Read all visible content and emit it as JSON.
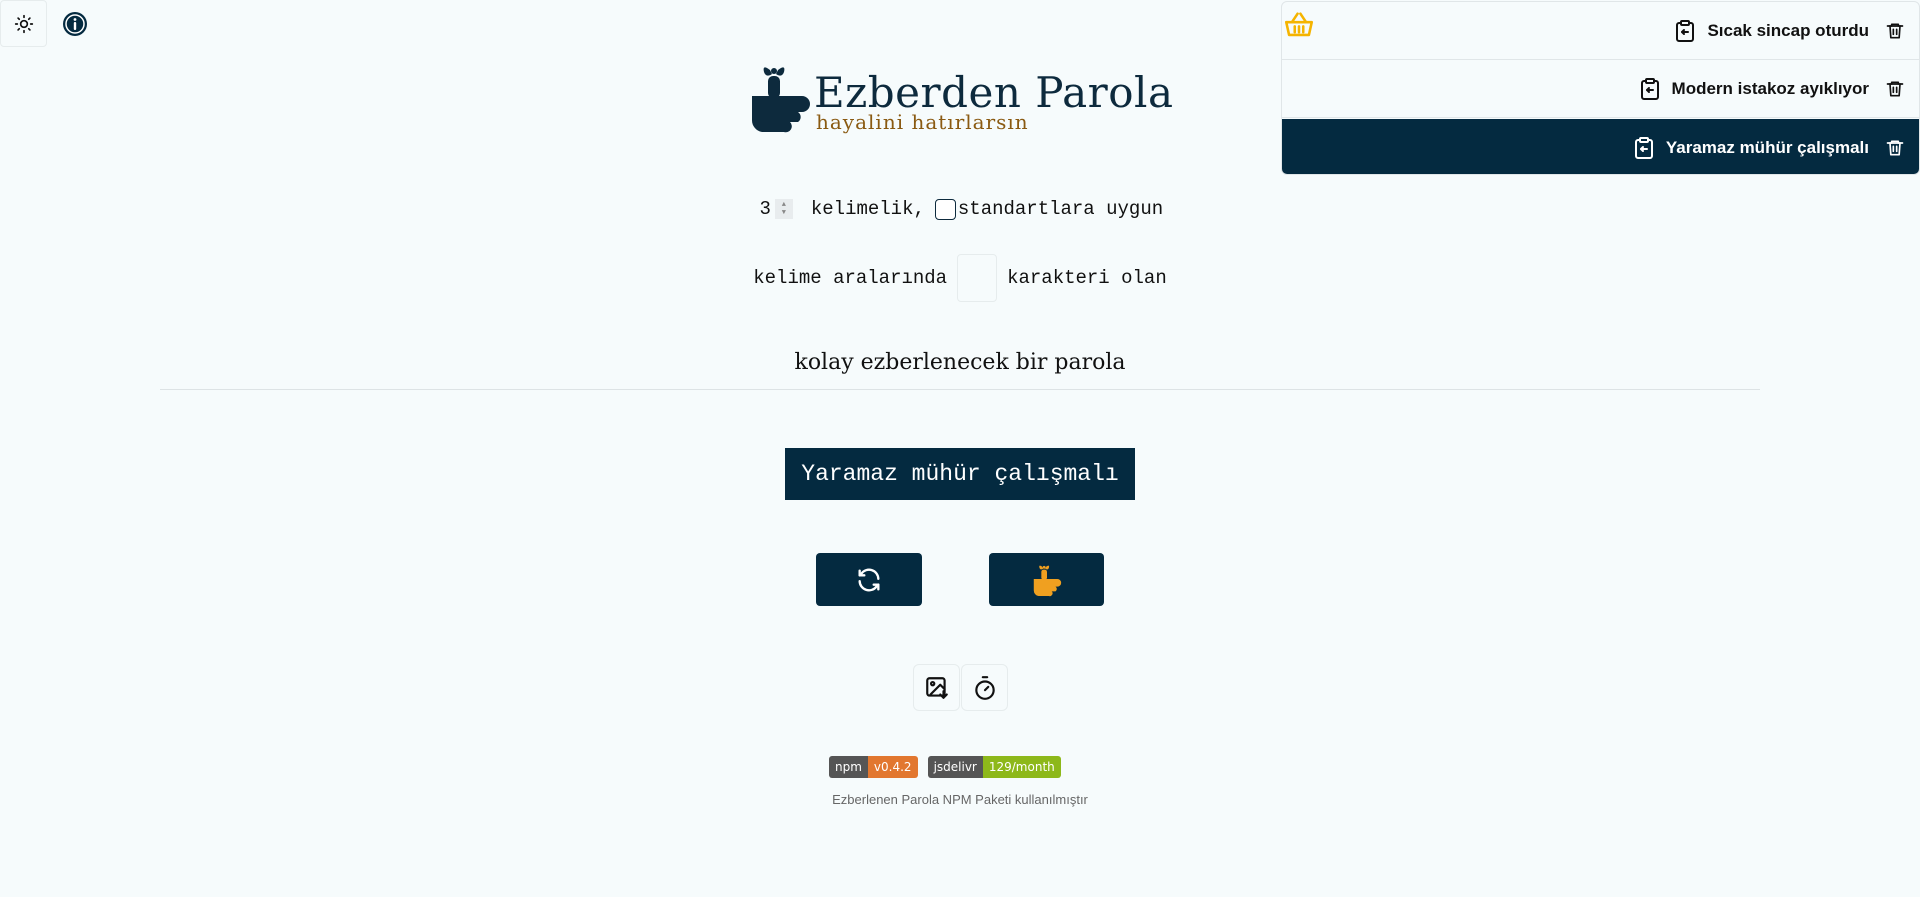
{
  "header": {
    "theme_icon": "sun-icon",
    "info_icon": "info-icon"
  },
  "logo": {
    "title": "Ezberden Parola",
    "subtitle": "hayalini hatırlarsın",
    "title_color": "#0d2a3d",
    "subtitle_color": "#8a5a12"
  },
  "options": {
    "word_count": "3",
    "word_count_suffix": "kelimelik,",
    "standard_label": "standartlara uygun",
    "separator_prefix": "kelime aralarında",
    "separator_value": "",
    "separator_suffix": "karakteri olan"
  },
  "main": {
    "heading": "kolay ezberlenecek bir parola",
    "password": "Yaramaz mühür çalışmalı",
    "refresh_icon": "refresh-icon",
    "remember_icon": "finger-bow-icon"
  },
  "tools": {
    "image_download_icon": "image-download-icon",
    "timer_icon": "stopwatch-icon"
  },
  "badges": [
    {
      "left": "npm",
      "right": "v0.4.2",
      "color": "#e2772f"
    },
    {
      "left": "jsdelivr",
      "right": "129/month",
      "color": "#8db81a"
    }
  ],
  "footer": {
    "note": "Ezberlenen Parola NPM Paketi kullanılmıştır"
  },
  "basket": {
    "icon": "basket-icon",
    "items": [
      {
        "label": "Sıcak sincap oturdu",
        "active": false
      },
      {
        "label": "Modern istakoz ayıklıyor",
        "active": false
      },
      {
        "label": "Yaramaz mühür çalışmalı",
        "active": true
      }
    ]
  },
  "colors": {
    "accent": "#042a40",
    "background": "#f6fbfc",
    "basket_icon": "#f5b400"
  }
}
